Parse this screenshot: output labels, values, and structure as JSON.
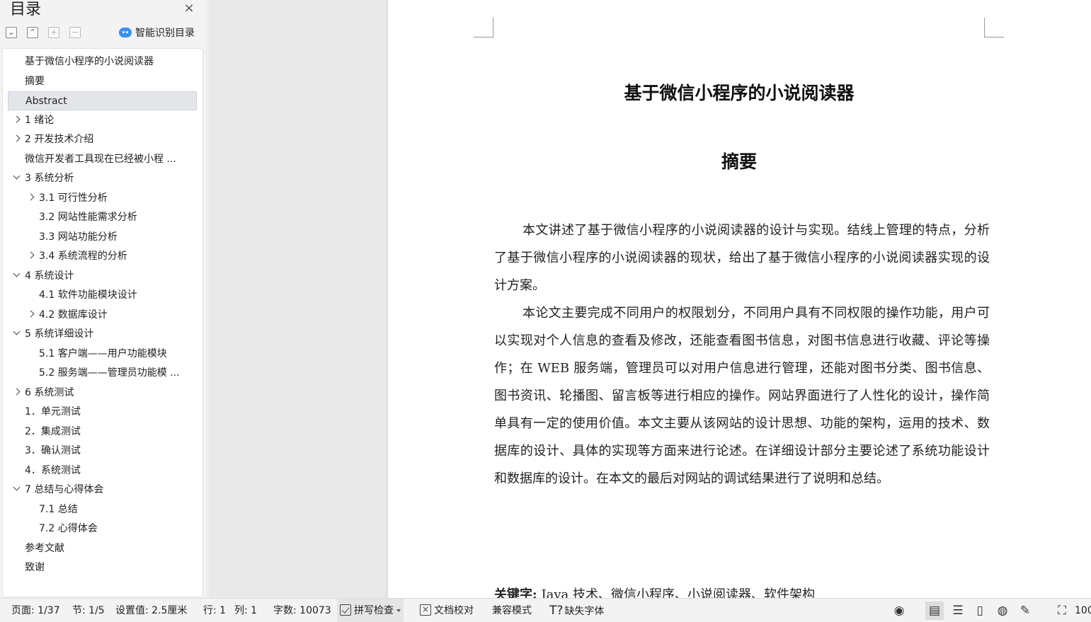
{
  "sidebar": {
    "title": "目录",
    "close_icon": "×",
    "tools": [
      "⌄",
      "⌃",
      "+",
      "−"
    ],
    "smart_label": "智能识别目录"
  },
  "toc": [
    {
      "label": "基于微信小程序的小说阅读器",
      "level": 0,
      "chevron": "none",
      "selected": false
    },
    {
      "label": "摘要",
      "level": 0,
      "chevron": "none",
      "selected": false
    },
    {
      "label": "Abstract",
      "level": 0,
      "chevron": "none",
      "selected": true
    },
    {
      "label": "1 绪论",
      "level": 0,
      "chevron": "right",
      "selected": false
    },
    {
      "label": "2 开发技术介绍",
      "level": 0,
      "chevron": "right",
      "selected": false
    },
    {
      "label": "微信开发者工具现在已经被小程 ...",
      "level": 0,
      "chevron": "none",
      "selected": false
    },
    {
      "label": "3 系统分析",
      "level": 0,
      "chevron": "down",
      "selected": false
    },
    {
      "label": "3.1 可行性分析",
      "level": 1,
      "chevron": "right",
      "selected": false
    },
    {
      "label": "3.2 网站性能需求分析",
      "level": 1,
      "chevron": "none",
      "selected": false
    },
    {
      "label": "3.3 网站功能分析",
      "level": 1,
      "chevron": "none",
      "selected": false
    },
    {
      "label": "3.4 系统流程的分析",
      "level": 1,
      "chevron": "right",
      "selected": false
    },
    {
      "label": "4 系统设计",
      "level": 0,
      "chevron": "down",
      "selected": false
    },
    {
      "label": "4.1  软件功能模块设计",
      "level": 1,
      "chevron": "none",
      "selected": false
    },
    {
      "label": "4.2  数据库设计",
      "level": 1,
      "chevron": "right",
      "selected": false
    },
    {
      "label": "5 系统详细设计",
      "level": 0,
      "chevron": "down",
      "selected": false
    },
    {
      "label": "5.1 客户端——用户功能模块",
      "level": 1,
      "chevron": "none",
      "selected": false
    },
    {
      "label": "5.2 服务端——管理员功能模 ...",
      "level": 1,
      "chevron": "none",
      "selected": false
    },
    {
      "label": "6 系统测试",
      "level": 0,
      "chevron": "right",
      "selected": false
    },
    {
      "label": "1．单元测试",
      "level": 0,
      "chevron": "none",
      "selected": false
    },
    {
      "label": "2．集成测试",
      "level": 0,
      "chevron": "none",
      "selected": false
    },
    {
      "label": "3．确认测试",
      "level": 0,
      "chevron": "none",
      "selected": false
    },
    {
      "label": "4．系统测试",
      "level": 0,
      "chevron": "none",
      "selected": false
    },
    {
      "label": "7 总结与心得体会",
      "level": 0,
      "chevron": "down",
      "selected": false
    },
    {
      "label": "7.1  总结",
      "level": 1,
      "chevron": "none",
      "selected": false
    },
    {
      "label": "7.2  心得体会",
      "level": 1,
      "chevron": "none",
      "selected": false
    },
    {
      "label": "参考文献",
      "level": 0,
      "chevron": "none",
      "selected": false
    },
    {
      "label": "致谢",
      "level": 0,
      "chevron": "none",
      "selected": false
    }
  ],
  "document": {
    "title": "基于微信小程序的小说阅读器",
    "abstract_heading": "摘要",
    "paragraph1": "本文讲述了基于微信小程序的小说阅读器的设计与实现。结线上管理的特点，分析了基于微信小程序的小说阅读器的现状，给出了基于微信小程序的小说阅读器实现的设计方案。",
    "paragraph2": "本论文主要完成不同用户的权限划分，不同用户具有不同权限的操作功能，用户可以实现对个人信息的查看及修改，还能查看图书信息，对图书信息进行收藏、评论等操作；在 WEB 服务端，管理员可以对用户信息进行管理，还能对图书分类、图书信息、图书资讯、轮播图、留言板等进行相应的操作。网站界面进行了人性化的设计，操作简单具有一定的使用价值。本文主要从该网站的设计思想、功能的架构，运用的技术、数据库的设计、具体的实现等方面来进行论述。在详细设计部分主要论述了系统功能设计和数据库的设计。在本文的最后对网站的调试结果进行了说明和总结。",
    "keywords_label": "关键字:",
    "keywords_value": " Java 技术、微信小程序、小说阅读器、软件架构"
  },
  "statusbar": {
    "page": "页面: 1/37",
    "section": "节: 1/5",
    "setting": "设置值: 2.5厘米",
    "row": "行: 1",
    "col": "列: 1",
    "wordcount": "字数: 10073",
    "spellcheck": "拼写检查",
    "proofread": "文档校对",
    "compat": "兼容模式",
    "missing_font": "缺失字体",
    "zoom": "100"
  }
}
